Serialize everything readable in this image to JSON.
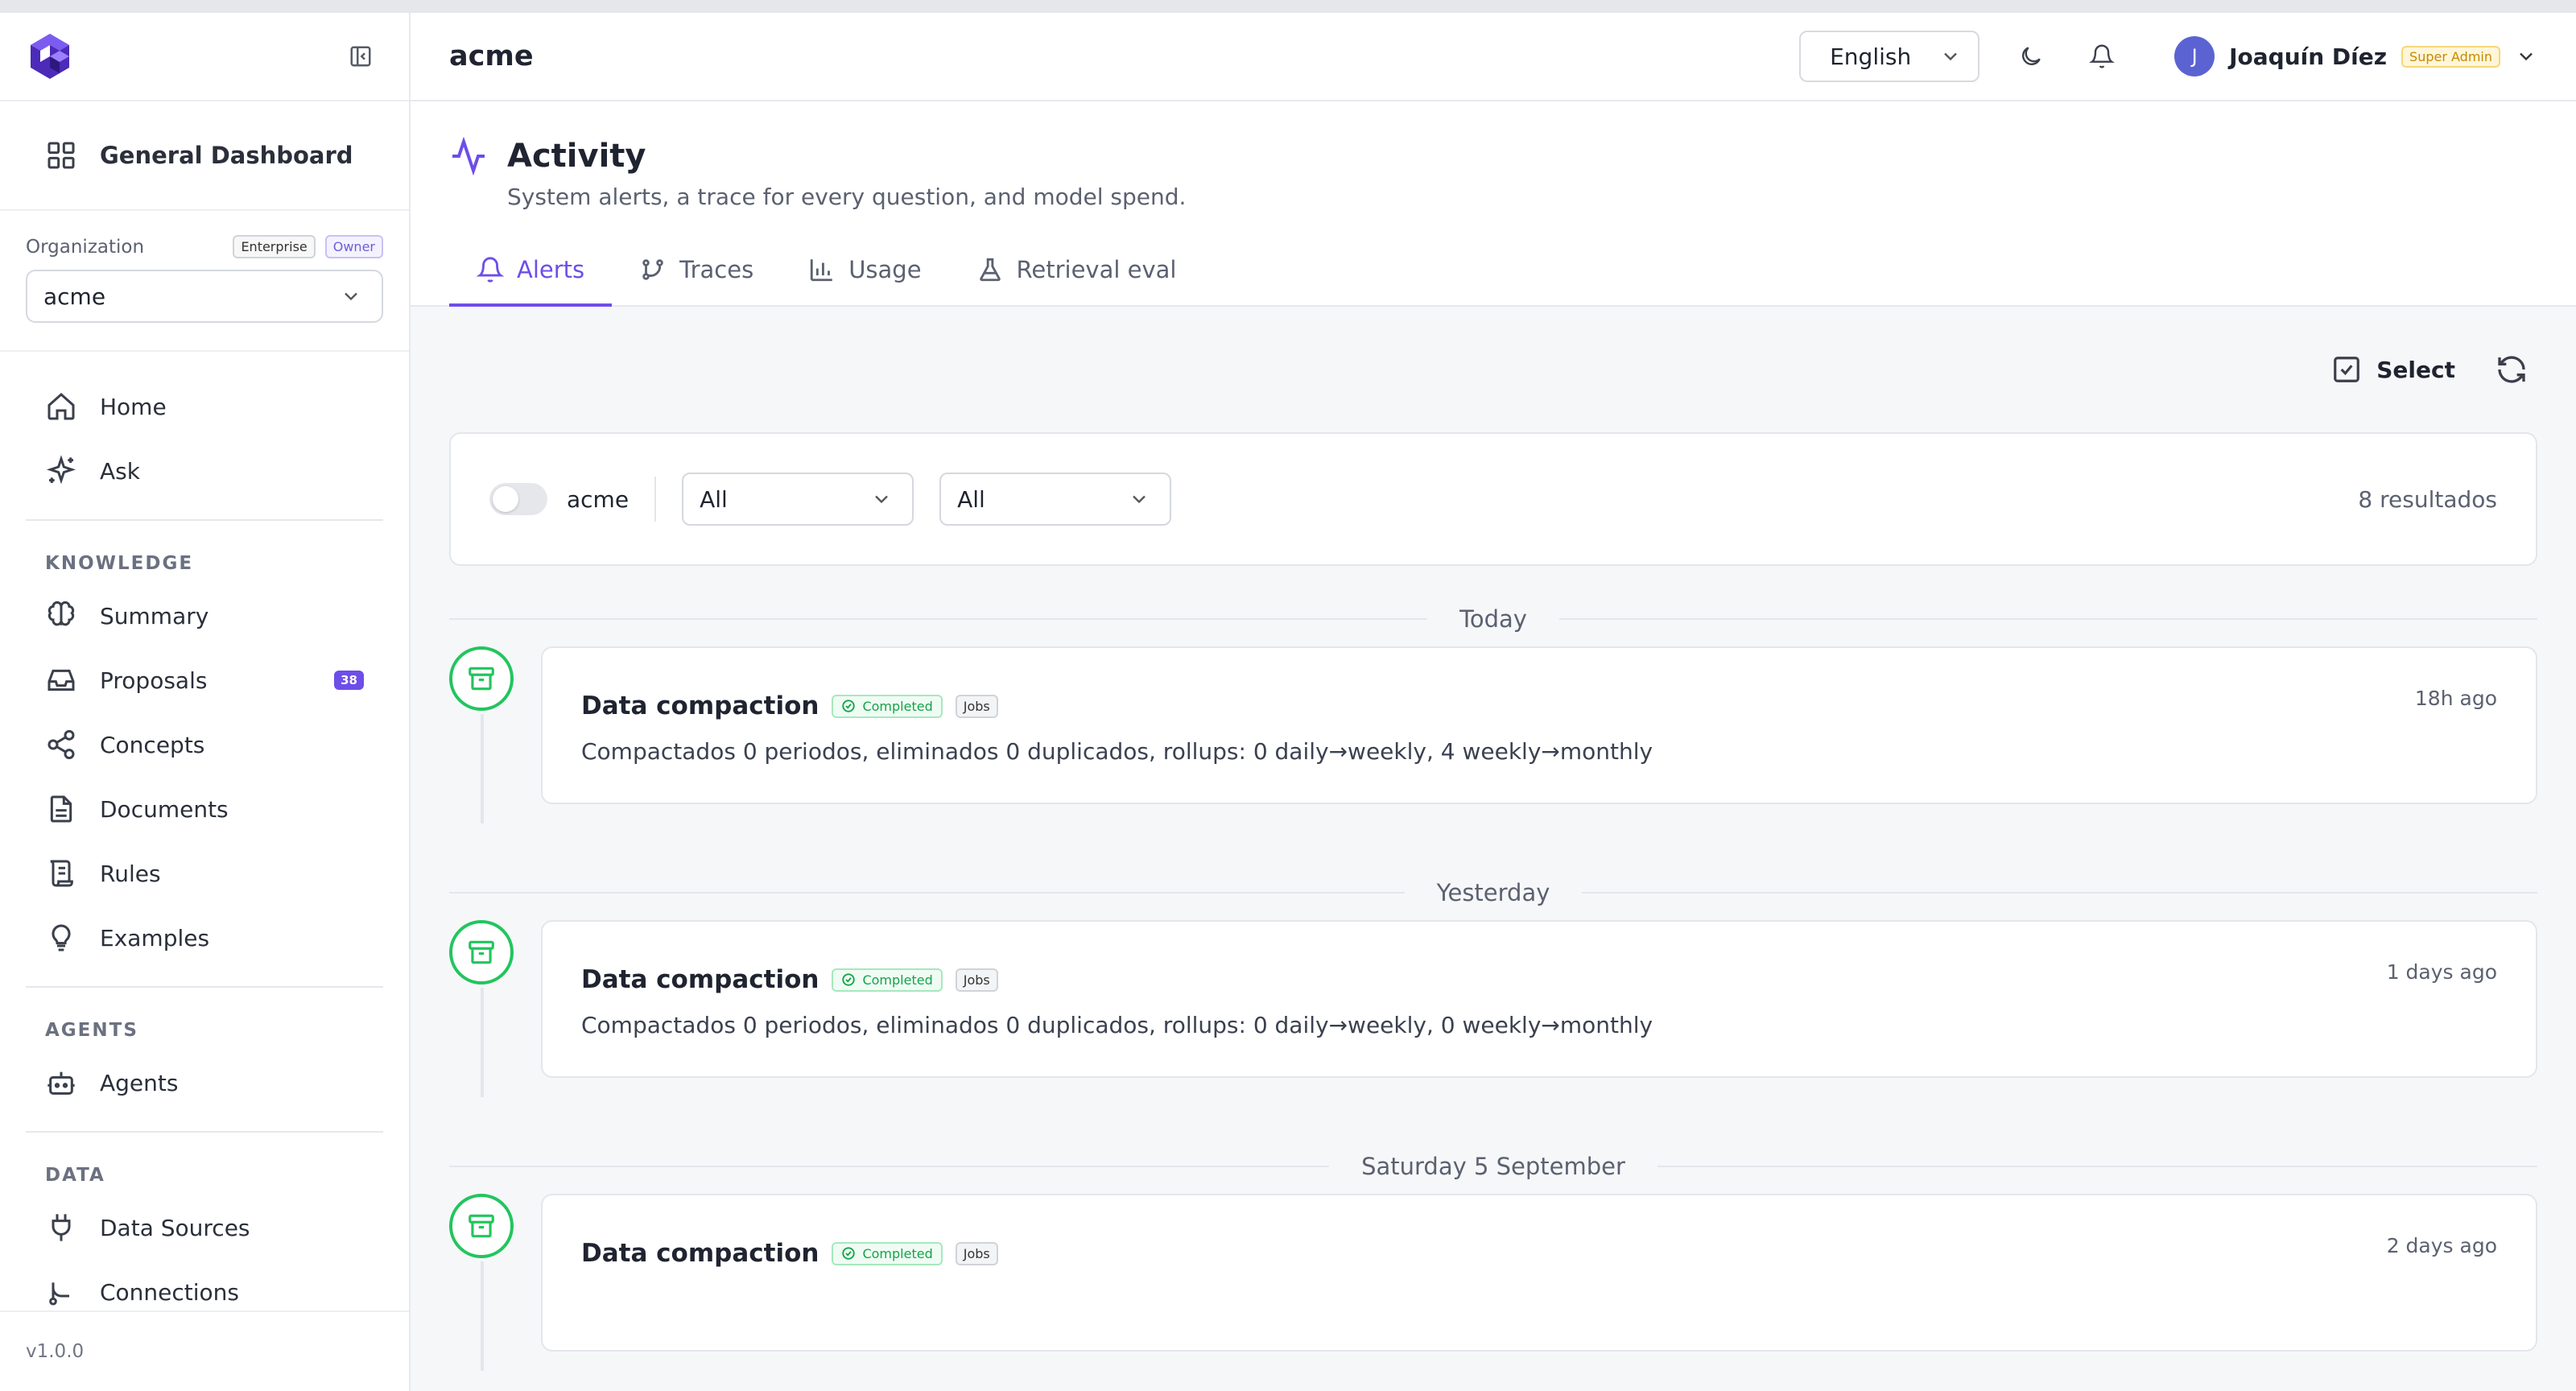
{
  "app": {
    "version": "v1.0.0",
    "breadcrumb": "acme"
  },
  "sidebar": {
    "dashboard_label": "General Dashboard",
    "organization_label": "Organization",
    "badge_enterprise": "Enterprise",
    "badge_owner": "Owner",
    "org_selected": "acme",
    "items_main": [
      {
        "label": "Home",
        "icon": "home-icon"
      },
      {
        "label": "Ask",
        "icon": "sparkles-icon"
      }
    ],
    "section_knowledge": "KNOWLEDGE",
    "items_knowledge": [
      {
        "label": "Summary",
        "icon": "brain-icon"
      },
      {
        "label": "Proposals",
        "icon": "inbox-icon",
        "count": "38"
      },
      {
        "label": "Concepts",
        "icon": "share-icon"
      },
      {
        "label": "Documents",
        "icon": "document-icon"
      },
      {
        "label": "Rules",
        "icon": "scroll-icon"
      },
      {
        "label": "Examples",
        "icon": "lightbulb-icon"
      }
    ],
    "section_agents": "AGENTS",
    "items_agents": [
      {
        "label": "Agents",
        "icon": "bot-icon"
      }
    ],
    "section_data": "DATA",
    "items_data": [
      {
        "label": "Data Sources",
        "icon": "plug-icon"
      },
      {
        "label": "Connections",
        "icon": "connection-icon"
      }
    ]
  },
  "topbar": {
    "language": "English",
    "user_initial": "J",
    "user_name": "Joaquín Díez",
    "user_role": "Super Admin"
  },
  "page": {
    "title": "Activity",
    "subtitle": "System alerts, a trace for every question, and model spend.",
    "tabs": [
      {
        "label": "Alerts",
        "active": true
      },
      {
        "label": "Traces"
      },
      {
        "label": "Usage"
      },
      {
        "label": "Retrieval eval"
      }
    ]
  },
  "actions": {
    "select_label": "Select"
  },
  "filters": {
    "toggle_label": "acme",
    "filter1": "All",
    "filter2": "All",
    "results": "8 resultados"
  },
  "groups": [
    {
      "day": "Today",
      "alerts": [
        {
          "title": "Data compaction",
          "status": "Completed",
          "tag": "Jobs",
          "time": "18h ago",
          "description": "Compactados 0 periodos, eliminados 0 duplicados, rollups: 0 daily→weekly, 4 weekly→monthly"
        }
      ]
    },
    {
      "day": "Yesterday",
      "alerts": [
        {
          "title": "Data compaction",
          "status": "Completed",
          "tag": "Jobs",
          "time": "1 days ago",
          "description": "Compactados 0 periodos, eliminados 0 duplicados, rollups: 0 daily→weekly, 0 weekly→monthly"
        }
      ]
    },
    {
      "day": "Saturday 5 September",
      "alerts": [
        {
          "title": "Data compaction",
          "status": "Completed",
          "tag": "Jobs",
          "time": "2 days ago",
          "description": ""
        }
      ]
    }
  ],
  "colors": {
    "accent": "#6d4ee9",
    "success": "#22c55e",
    "warning_badge": "#c58a00"
  }
}
